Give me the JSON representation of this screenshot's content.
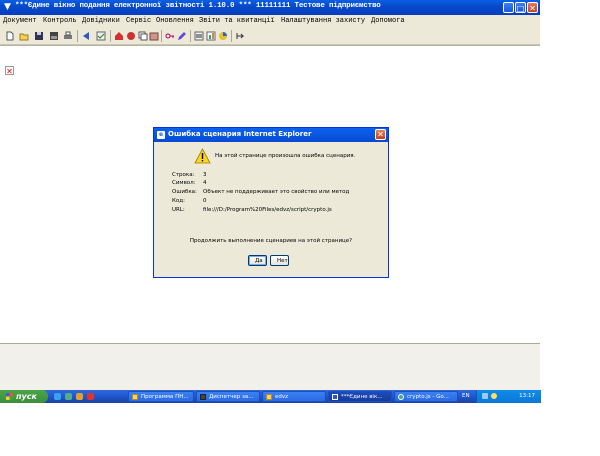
{
  "window": {
    "title": "***Єдине вікно подання електронної звітності 1.10.0 *** 11111111 Тестове підприємство"
  },
  "menu": [
    "Документ",
    "Контроль",
    "Довідники",
    "Сервіс",
    "Оновлення",
    "Звіти та квитанції",
    "Налаштування захисту",
    "Допомога"
  ],
  "toolbar": {
    "icons": [
      "new-document-icon",
      "open-folder-icon",
      "save-icon",
      "save-all-icon",
      "print-icon",
      "send-icon",
      "check-icon",
      "house-icon",
      "sign-icon",
      "copy-icon",
      "archive-icon",
      "key-icon",
      "edit-icon",
      "settings-icon",
      "chart-icon",
      "report-icon",
      "export-icon"
    ]
  },
  "dialog": {
    "title": "Ошибка сценария Internet Explorer",
    "message": "На этой странице произошла ошибка сценария.",
    "rows": [
      {
        "label": "Строка:",
        "value": "3"
      },
      {
        "label": "Символ:",
        "value": "4"
      },
      {
        "label": "Ошибка:",
        "value": "Объект не поддерживает это свойство или метод"
      },
      {
        "label": "Код:",
        "value": "0"
      },
      {
        "label": "URL:",
        "value": "file:///D:/Program%20Files/edvz/script/crypto.js"
      }
    ],
    "question": "Продолжить выполнение сценариев на этой странице?",
    "yes": "Да",
    "no": "Нет"
  },
  "taskbar": {
    "start": "пуск",
    "tasks": [
      {
        "label": "Программа ПН..."
      },
      {
        "label": "Диспетчер за..."
      },
      {
        "label": "edvz"
      },
      {
        "label": "***Єдине вік..."
      },
      {
        "label": "crypto.js - Go..."
      }
    ],
    "lang": "EN",
    "clock": "13:17"
  },
  "colors": {
    "titlebar": "#0848c9",
    "dialog_border": "#0831d9",
    "taskbar": "#245edb",
    "start_button": "#3c8e3c"
  }
}
